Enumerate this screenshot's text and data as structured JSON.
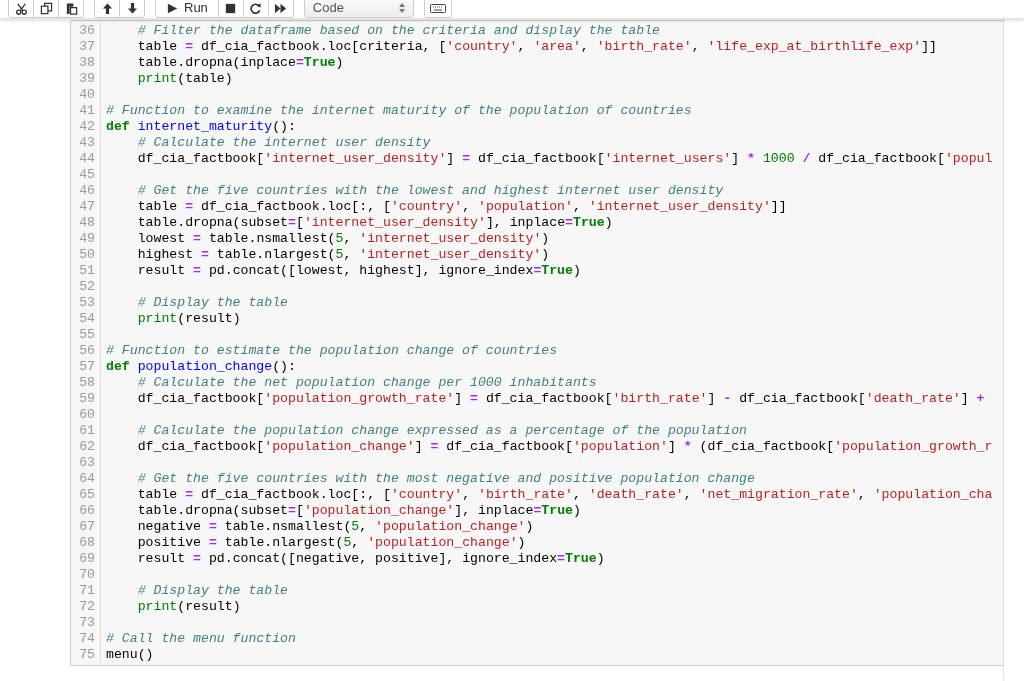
{
  "toolbar": {
    "groups": [
      {
        "buttons": [
          {
            "kind": "cut"
          },
          {
            "kind": "copy"
          },
          {
            "kind": "paste"
          }
        ]
      },
      {
        "buttons": [
          {
            "kind": "move-up"
          },
          {
            "kind": "move-down"
          }
        ]
      },
      {
        "buttons": [
          {
            "kind": "run",
            "label": "Run"
          },
          {
            "kind": "stop"
          },
          {
            "kind": "restart"
          },
          {
            "kind": "run-all"
          }
        ]
      }
    ],
    "cell_type": {
      "value": "Code"
    }
  },
  "code_cell": {
    "lines": [
      {
        "number": "36",
        "tokens": [
          {
            "kind": "comment",
            "text": "    # Filter the dataframe based on the criteria and display the table"
          }
        ]
      },
      {
        "number": "37",
        "tokens": [
          {
            "kind": "plain",
            "text": "    table "
          },
          {
            "kind": "operator",
            "text": "="
          },
          {
            "kind": "plain",
            "text": " df_cia_factbook.loc[criteria, ["
          },
          {
            "kind": "string",
            "text": "'country'"
          },
          {
            "kind": "plain",
            "text": ", "
          },
          {
            "kind": "string",
            "text": "'area'"
          },
          {
            "kind": "plain",
            "text": ", "
          },
          {
            "kind": "string",
            "text": "'birth_rate'"
          },
          {
            "kind": "plain",
            "text": ", "
          },
          {
            "kind": "string",
            "text": "'life_exp_at_birthlife_exp'"
          },
          {
            "kind": "plain",
            "text": "]]"
          }
        ]
      },
      {
        "number": "38",
        "tokens": [
          {
            "kind": "plain",
            "text": "    table.dropna(inplace"
          },
          {
            "kind": "operator",
            "text": "="
          },
          {
            "kind": "keyword",
            "text": "True"
          },
          {
            "kind": "plain",
            "text": ")"
          }
        ]
      },
      {
        "number": "39",
        "tokens": [
          {
            "kind": "builtin",
            "text": "    print"
          },
          {
            "kind": "plain",
            "text": "(table)"
          }
        ]
      },
      {
        "number": "40"
      },
      {
        "number": "41",
        "tokens": [
          {
            "kind": "comment",
            "text": "# Function to examine the internet maturity of the population of countries"
          }
        ]
      },
      {
        "number": "42",
        "tokens": [
          {
            "kind": "keyword",
            "text": "def "
          },
          {
            "kind": "function",
            "text": "internet_maturity"
          },
          {
            "kind": "plain",
            "text": "():"
          }
        ]
      },
      {
        "number": "43",
        "tokens": [
          {
            "kind": "comment",
            "text": "    # Calculate the internet user density"
          }
        ]
      },
      {
        "number": "44",
        "tokens": [
          {
            "kind": "plain",
            "text": "    df_cia_factbook["
          },
          {
            "kind": "string",
            "text": "'internet_user_density'"
          },
          {
            "kind": "plain",
            "text": "] "
          },
          {
            "kind": "operator",
            "text": "="
          },
          {
            "kind": "plain",
            "text": " df_cia_factbook["
          },
          {
            "kind": "string",
            "text": "'internet_users'"
          },
          {
            "kind": "plain",
            "text": "] "
          },
          {
            "kind": "operator",
            "text": "*"
          },
          {
            "kind": "number",
            "text": " 1000 "
          },
          {
            "kind": "operator",
            "text": "/"
          },
          {
            "kind": "plain",
            "text": " df_cia_factbook["
          },
          {
            "kind": "string",
            "text": "'popul"
          }
        ]
      },
      {
        "number": "45"
      },
      {
        "number": "46",
        "tokens": [
          {
            "kind": "comment",
            "text": "    # Get the five countries with the lowest and highest internet user density"
          }
        ]
      },
      {
        "number": "47",
        "tokens": [
          {
            "kind": "plain",
            "text": "    table "
          },
          {
            "kind": "operator",
            "text": "="
          },
          {
            "kind": "plain",
            "text": " df_cia_factbook.loc[:, ["
          },
          {
            "kind": "string",
            "text": "'country'"
          },
          {
            "kind": "plain",
            "text": ", "
          },
          {
            "kind": "string",
            "text": "'population'"
          },
          {
            "kind": "plain",
            "text": ", "
          },
          {
            "kind": "string",
            "text": "'internet_user_density'"
          },
          {
            "kind": "plain",
            "text": "]]"
          }
        ]
      },
      {
        "number": "48",
        "tokens": [
          {
            "kind": "plain",
            "text": "    table.dropna(subset"
          },
          {
            "kind": "operator",
            "text": "="
          },
          {
            "kind": "plain",
            "text": "["
          },
          {
            "kind": "string",
            "text": "'internet_user_density'"
          },
          {
            "kind": "plain",
            "text": "], inplace"
          },
          {
            "kind": "operator",
            "text": "="
          },
          {
            "kind": "keyword",
            "text": "True"
          },
          {
            "kind": "plain",
            "text": ")"
          }
        ]
      },
      {
        "number": "49",
        "tokens": [
          {
            "kind": "plain",
            "text": "    lowest "
          },
          {
            "kind": "operator",
            "text": "="
          },
          {
            "kind": "plain",
            "text": " table.nsmallest("
          },
          {
            "kind": "number",
            "text": "5"
          },
          {
            "kind": "plain",
            "text": ", "
          },
          {
            "kind": "string",
            "text": "'internet_user_density'"
          },
          {
            "kind": "plain",
            "text": ")"
          }
        ]
      },
      {
        "number": "50",
        "tokens": [
          {
            "kind": "plain",
            "text": "    highest "
          },
          {
            "kind": "operator",
            "text": "="
          },
          {
            "kind": "plain",
            "text": " table.nlargest("
          },
          {
            "kind": "number",
            "text": "5"
          },
          {
            "kind": "plain",
            "text": ", "
          },
          {
            "kind": "string",
            "text": "'internet_user_density'"
          },
          {
            "kind": "plain",
            "text": ")"
          }
        ]
      },
      {
        "number": "51",
        "tokens": [
          {
            "kind": "plain",
            "text": "    result "
          },
          {
            "kind": "operator",
            "text": "="
          },
          {
            "kind": "plain",
            "text": " pd.concat([lowest, highest], ignore_index"
          },
          {
            "kind": "operator",
            "text": "="
          },
          {
            "kind": "keyword",
            "text": "True"
          },
          {
            "kind": "plain",
            "text": ")"
          }
        ]
      },
      {
        "number": "52"
      },
      {
        "number": "53",
        "tokens": [
          {
            "kind": "comment",
            "text": "    # Display the table"
          }
        ]
      },
      {
        "number": "54",
        "tokens": [
          {
            "kind": "builtin",
            "text": "    print"
          },
          {
            "kind": "plain",
            "text": "(result)"
          }
        ]
      },
      {
        "number": "55"
      },
      {
        "number": "56",
        "tokens": [
          {
            "kind": "comment",
            "text": "# Function to estimate the population change of countries"
          }
        ]
      },
      {
        "number": "57",
        "tokens": [
          {
            "kind": "keyword",
            "text": "def "
          },
          {
            "kind": "function",
            "text": "population_change"
          },
          {
            "kind": "plain",
            "text": "():"
          }
        ]
      },
      {
        "number": "58",
        "tokens": [
          {
            "kind": "comment",
            "text": "    # Calculate the net population change per 1000 inhabitants"
          }
        ]
      },
      {
        "number": "59",
        "tokens": [
          {
            "kind": "plain",
            "text": "    df_cia_factbook["
          },
          {
            "kind": "string",
            "text": "'population_growth_rate'"
          },
          {
            "kind": "plain",
            "text": "] "
          },
          {
            "kind": "operator",
            "text": "="
          },
          {
            "kind": "plain",
            "text": " df_cia_factbook["
          },
          {
            "kind": "string",
            "text": "'birth_rate'"
          },
          {
            "kind": "plain",
            "text": "] "
          },
          {
            "kind": "operator",
            "text": "-"
          },
          {
            "kind": "plain",
            "text": " df_cia_factbook["
          },
          {
            "kind": "string",
            "text": "'death_rate'"
          },
          {
            "kind": "plain",
            "text": "] "
          },
          {
            "kind": "operator",
            "text": "+"
          }
        ]
      },
      {
        "number": "60"
      },
      {
        "number": "61",
        "tokens": [
          {
            "kind": "comment",
            "text": "    # Calculate the population change expressed as a percentage of the population"
          }
        ]
      },
      {
        "number": "62",
        "tokens": [
          {
            "kind": "plain",
            "text": "    df_cia_factbook["
          },
          {
            "kind": "string",
            "text": "'population_change'"
          },
          {
            "kind": "plain",
            "text": "] "
          },
          {
            "kind": "operator",
            "text": "="
          },
          {
            "kind": "plain",
            "text": " df_cia_factbook["
          },
          {
            "kind": "string",
            "text": "'population'"
          },
          {
            "kind": "plain",
            "text": "] "
          },
          {
            "kind": "operator",
            "text": "*"
          },
          {
            "kind": "plain",
            "text": " (df_cia_factbook["
          },
          {
            "kind": "string",
            "text": "'population_growth_r"
          }
        ]
      },
      {
        "number": "63"
      },
      {
        "number": "64",
        "tokens": [
          {
            "kind": "comment",
            "text": "    # Get the five countries with the most negative and positive population change"
          }
        ]
      },
      {
        "number": "65",
        "tokens": [
          {
            "kind": "plain",
            "text": "    table "
          },
          {
            "kind": "operator",
            "text": "="
          },
          {
            "kind": "plain",
            "text": " df_cia_factbook.loc[:, ["
          },
          {
            "kind": "string",
            "text": "'country'"
          },
          {
            "kind": "plain",
            "text": ", "
          },
          {
            "kind": "string",
            "text": "'birth_rate'"
          },
          {
            "kind": "plain",
            "text": ", "
          },
          {
            "kind": "string",
            "text": "'death_rate'"
          },
          {
            "kind": "plain",
            "text": ", "
          },
          {
            "kind": "string",
            "text": "'net_migration_rate'"
          },
          {
            "kind": "plain",
            "text": ", "
          },
          {
            "kind": "string",
            "text": "'population_cha"
          }
        ]
      },
      {
        "number": "66",
        "tokens": [
          {
            "kind": "plain",
            "text": "    table.dropna(subset"
          },
          {
            "kind": "operator",
            "text": "="
          },
          {
            "kind": "plain",
            "text": "["
          },
          {
            "kind": "string",
            "text": "'population_change'"
          },
          {
            "kind": "plain",
            "text": "], inplace"
          },
          {
            "kind": "operator",
            "text": "="
          },
          {
            "kind": "keyword",
            "text": "True"
          },
          {
            "kind": "plain",
            "text": ")"
          }
        ]
      },
      {
        "number": "67",
        "tokens": [
          {
            "kind": "plain",
            "text": "    negative "
          },
          {
            "kind": "operator",
            "text": "="
          },
          {
            "kind": "plain",
            "text": " table.nsmallest("
          },
          {
            "kind": "number",
            "text": "5"
          },
          {
            "kind": "plain",
            "text": ", "
          },
          {
            "kind": "string",
            "text": "'population_change'"
          },
          {
            "kind": "plain",
            "text": ")"
          }
        ]
      },
      {
        "number": "68",
        "tokens": [
          {
            "kind": "plain",
            "text": "    positive "
          },
          {
            "kind": "operator",
            "text": "="
          },
          {
            "kind": "plain",
            "text": " table.nlargest("
          },
          {
            "kind": "number",
            "text": "5"
          },
          {
            "kind": "plain",
            "text": ", "
          },
          {
            "kind": "string",
            "text": "'population_change'"
          },
          {
            "kind": "plain",
            "text": ")"
          }
        ]
      },
      {
        "number": "69",
        "tokens": [
          {
            "kind": "plain",
            "text": "    result "
          },
          {
            "kind": "operator",
            "text": "="
          },
          {
            "kind": "plain",
            "text": " pd.concat([negative, positive], ignore_index"
          },
          {
            "kind": "operator",
            "text": "="
          },
          {
            "kind": "keyword",
            "text": "True"
          },
          {
            "kind": "plain",
            "text": ")"
          }
        ]
      },
      {
        "number": "70"
      },
      {
        "number": "71",
        "tokens": [
          {
            "kind": "comment",
            "text": "    # Display the table"
          }
        ]
      },
      {
        "number": "72",
        "tokens": [
          {
            "kind": "builtin",
            "text": "    print"
          },
          {
            "kind": "plain",
            "text": "(result)"
          }
        ]
      },
      {
        "number": "73"
      },
      {
        "number": "74",
        "tokens": [
          {
            "kind": "comment",
            "text": "# Call the menu function"
          }
        ]
      },
      {
        "number": "75",
        "tokens": [
          {
            "kind": "plain",
            "text": "menu()"
          }
        ]
      }
    ]
  }
}
